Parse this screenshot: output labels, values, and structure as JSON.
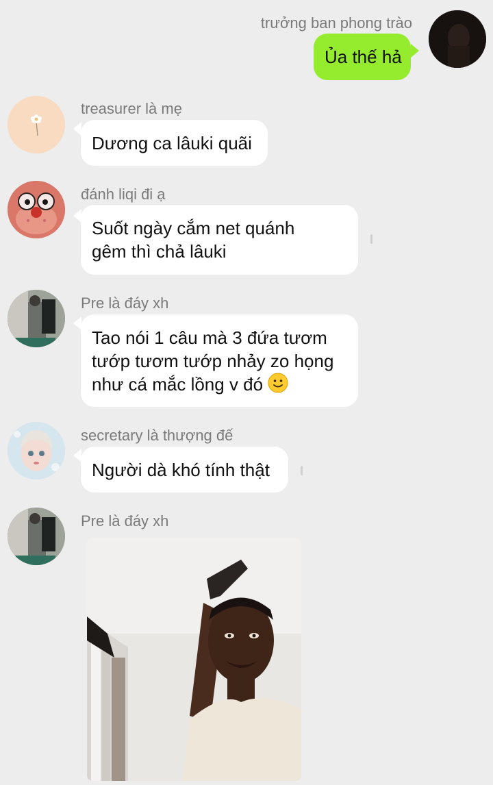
{
  "messages": [
    {
      "sender": "trưởng ban phong trào",
      "text": "Ủa thế hả"
    },
    {
      "sender": "treasurer là mẹ",
      "text": "Dương ca lâuki quãi"
    },
    {
      "sender": "đánh liqi đi ạ",
      "lines": [
        "Suốt ngày cắm net quánh",
        "gêm thì chả lâuki"
      ]
    },
    {
      "sender": "Pre là đáy xh",
      "lines": [
        "Tao nói 1 câu mà 3 đứa tươm",
        "tướp tươm tướp nhảy zo họng",
        "như cá mắc lồng v đó"
      ],
      "emoji": "slightly-smiling-face"
    },
    {
      "sender": "secretary là thượng đế",
      "text": "Người dà khó tính thật"
    },
    {
      "sender": "Pre là đáy xh",
      "image": "photo-message"
    }
  ],
  "colors": {
    "background": "#ededed",
    "outgoing_bubble": "#95ec2e",
    "incoming_bubble": "#ffffff",
    "name_text": "#7a7a7a"
  }
}
